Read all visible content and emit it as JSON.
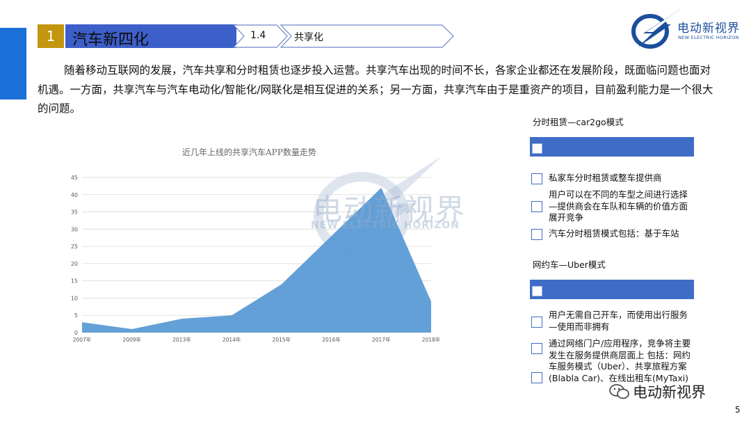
{
  "header": {
    "section_number": "1",
    "section_title": "汽车新四化",
    "subsection_number": "1.4",
    "subsection_title": "共享化"
  },
  "logo": {
    "name_cn": "电动新视界",
    "name_en": "NEW ELECTRIC HORIZON"
  },
  "intro": "随着移动互联网的发展，汽车共享和分时租赁也逐步投入运营。共享汽车出现的时间不长，各家企业都还在发展阶段，既面临问题也面对机遇。一方面，共享汽车与汽车电动化/智能化/网联化是相互促进的关系；另一方面，共享汽车由于是重资产的项目，目前盈利能力是一个很大的问题。",
  "chart_data": {
    "type": "area",
    "title": "近几年上线的共享汽车APP数量走势",
    "categories": [
      "2007年",
      "2009年",
      "2013年",
      "2014年",
      "2015年",
      "2016年",
      "2017年",
      "2018年"
    ],
    "values": [
      3,
      1,
      4,
      5,
      14,
      28,
      42,
      9
    ],
    "ylim": [
      0,
      45
    ],
    "yticks": [
      0,
      5,
      10,
      15,
      20,
      25,
      30,
      35,
      40,
      45
    ],
    "grid": true,
    "color": "#5b9bd5"
  },
  "panel": {
    "section1": {
      "title": "分时租赁—car2go模式",
      "items": [
        "私家车分时租赁或整车提供商",
        "用户可以在不同的车型之间进行选择—提供商会在车队和车辆的价值方面展开竞争",
        "汽车分时租赁模式包括：基于车站"
      ]
    },
    "section2": {
      "title": "网约车—Uber模式",
      "items": [
        "用户无需自己开车，而使用出行服务—使用而非拥有",
        "通过网络门户/应用程序，竞争将主要发生在服务提供商层面上 包括：网约车服务模式（Uber）、共享旅程方案(Blabla Car)、在线出租车(MyTaxi)"
      ]
    }
  },
  "watermark": {
    "cn": "电动新视界",
    "en": "NEW ELECTRIC HORIZON"
  },
  "footer": {
    "brand": "电动新视界",
    "page": "5"
  },
  "colors": {
    "accent_blue": "#1a6fd8",
    "title_bar": "#3d5fc9",
    "gold": "#c4960f",
    "panel_blue": "#3f6cc7"
  }
}
